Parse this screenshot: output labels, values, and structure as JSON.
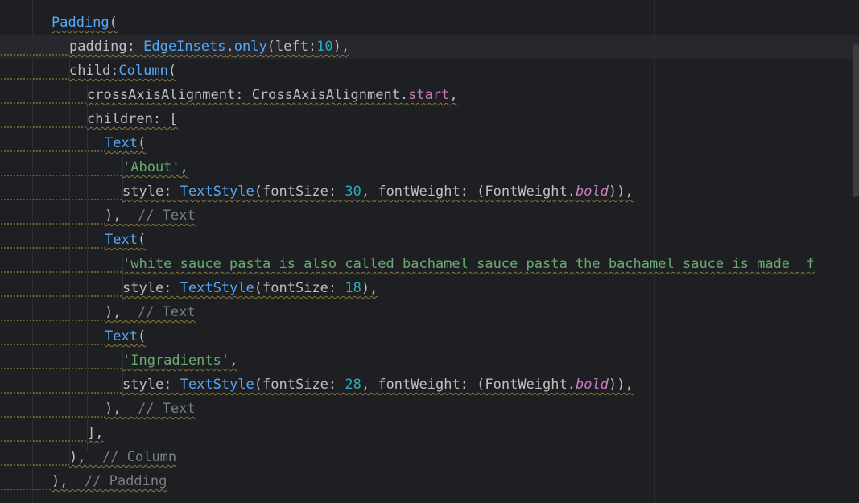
{
  "editor": {
    "lines": [
      {
        "id": "l1",
        "tokens": [
          {
            "t": "Padding",
            "c": "cls"
          },
          {
            "t": "(",
            "c": "kw"
          }
        ]
      },
      {
        "id": "l2",
        "tokens": [
          {
            "t": "padding: ",
            "c": "kw"
          },
          {
            "t": "EdgeInsets",
            "c": "cls"
          },
          {
            "t": ".",
            "c": "kw"
          },
          {
            "t": "only",
            "c": "cls"
          },
          {
            "t": "(left",
            "c": "kw"
          },
          {
            "t": ":",
            "c": "kw"
          },
          {
            "t": "10",
            "c": "num"
          },
          {
            "t": "),",
            "c": "kw"
          }
        ]
      },
      {
        "id": "l3",
        "tokens": [
          {
            "t": "child:",
            "c": "kw"
          },
          {
            "t": "Column",
            "c": "cls"
          },
          {
            "t": "(",
            "c": "kw"
          }
        ]
      },
      {
        "id": "l4",
        "tokens": [
          {
            "t": "crossAxisAlignment: CrossAxisAlignment.",
            "c": "kw"
          },
          {
            "t": "start",
            "c": "const"
          },
          {
            "t": ",",
            "c": "kw"
          }
        ]
      },
      {
        "id": "l5",
        "tokens": [
          {
            "t": "children: [",
            "c": "kw"
          }
        ]
      },
      {
        "id": "l6",
        "tokens": [
          {
            "t": "Text",
            "c": "cls"
          },
          {
            "t": "(",
            "c": "kw"
          }
        ]
      },
      {
        "id": "l7",
        "tokens": [
          {
            "t": "'About'",
            "c": "str"
          },
          {
            "t": ",",
            "c": "kw"
          }
        ]
      },
      {
        "id": "l8",
        "tokens": [
          {
            "t": "style: ",
            "c": "kw"
          },
          {
            "t": "TextStyle",
            "c": "cls"
          },
          {
            "t": "(fontSize: ",
            "c": "kw"
          },
          {
            "t": "30",
            "c": "num"
          },
          {
            "t": ", fontWeight: (FontWeight.",
            "c": "kw"
          },
          {
            "t": "bold",
            "c": "ital"
          },
          {
            "t": ")),",
            "c": "kw"
          }
        ]
      },
      {
        "id": "l9",
        "tokens": [
          {
            "t": "),  ",
            "c": "kw"
          },
          {
            "t": "// Text",
            "c": "cmt"
          }
        ]
      },
      {
        "id": "l10",
        "tokens": [
          {
            "t": "Text",
            "c": "cls"
          },
          {
            "t": "(",
            "c": "kw"
          }
        ]
      },
      {
        "id": "l11",
        "tokens": [
          {
            "t": "'white sauce pasta is also called bachamel sauce pasta the bachamel sauce is made  f",
            "c": "str"
          }
        ]
      },
      {
        "id": "l12",
        "tokens": [
          {
            "t": "style: ",
            "c": "kw"
          },
          {
            "t": "TextStyle",
            "c": "cls"
          },
          {
            "t": "(fontSize: ",
            "c": "kw"
          },
          {
            "t": "18",
            "c": "num"
          },
          {
            "t": "),",
            "c": "kw"
          }
        ]
      },
      {
        "id": "l13",
        "tokens": [
          {
            "t": "),  ",
            "c": "kw"
          },
          {
            "t": "// Text",
            "c": "cmt"
          }
        ]
      },
      {
        "id": "l14",
        "tokens": [
          {
            "t": "Text",
            "c": "cls"
          },
          {
            "t": "(",
            "c": "kw"
          }
        ]
      },
      {
        "id": "l15",
        "tokens": [
          {
            "t": "'Ingradients'",
            "c": "str"
          },
          {
            "t": ",",
            "c": "kw"
          }
        ]
      },
      {
        "id": "l16",
        "tokens": [
          {
            "t": "style: ",
            "c": "kw"
          },
          {
            "t": "TextStyle",
            "c": "cls"
          },
          {
            "t": "(fontSize: ",
            "c": "kw"
          },
          {
            "t": "28",
            "c": "num"
          },
          {
            "t": ", fontWeight: (FontWeight.",
            "c": "kw"
          },
          {
            "t": "bold",
            "c": "ital"
          },
          {
            "t": ")),",
            "c": "kw"
          }
        ]
      },
      {
        "id": "l17",
        "tokens": [
          {
            "t": "),  ",
            "c": "kw"
          },
          {
            "t": "// Text",
            "c": "cmt"
          }
        ]
      },
      {
        "id": "l18",
        "tokens": [
          {
            "t": "],",
            "c": "kw"
          }
        ]
      },
      {
        "id": "l19",
        "tokens": [
          {
            "t": "),  ",
            "c": "kw"
          },
          {
            "t": "// Column",
            "c": "cmt"
          }
        ]
      },
      {
        "id": "l20",
        "tokens": [
          {
            "t": "),  ",
            "c": "kw"
          },
          {
            "t": "// Padding",
            "c": "cmt"
          }
        ]
      }
    ],
    "colors": {
      "background": "#1e1f22",
      "class": "#56a8f5",
      "number": "#2aacb8",
      "string": "#6aab73",
      "comment": "#7a7e85",
      "constant": "#c77dbb",
      "text": "#bcbec4"
    }
  }
}
